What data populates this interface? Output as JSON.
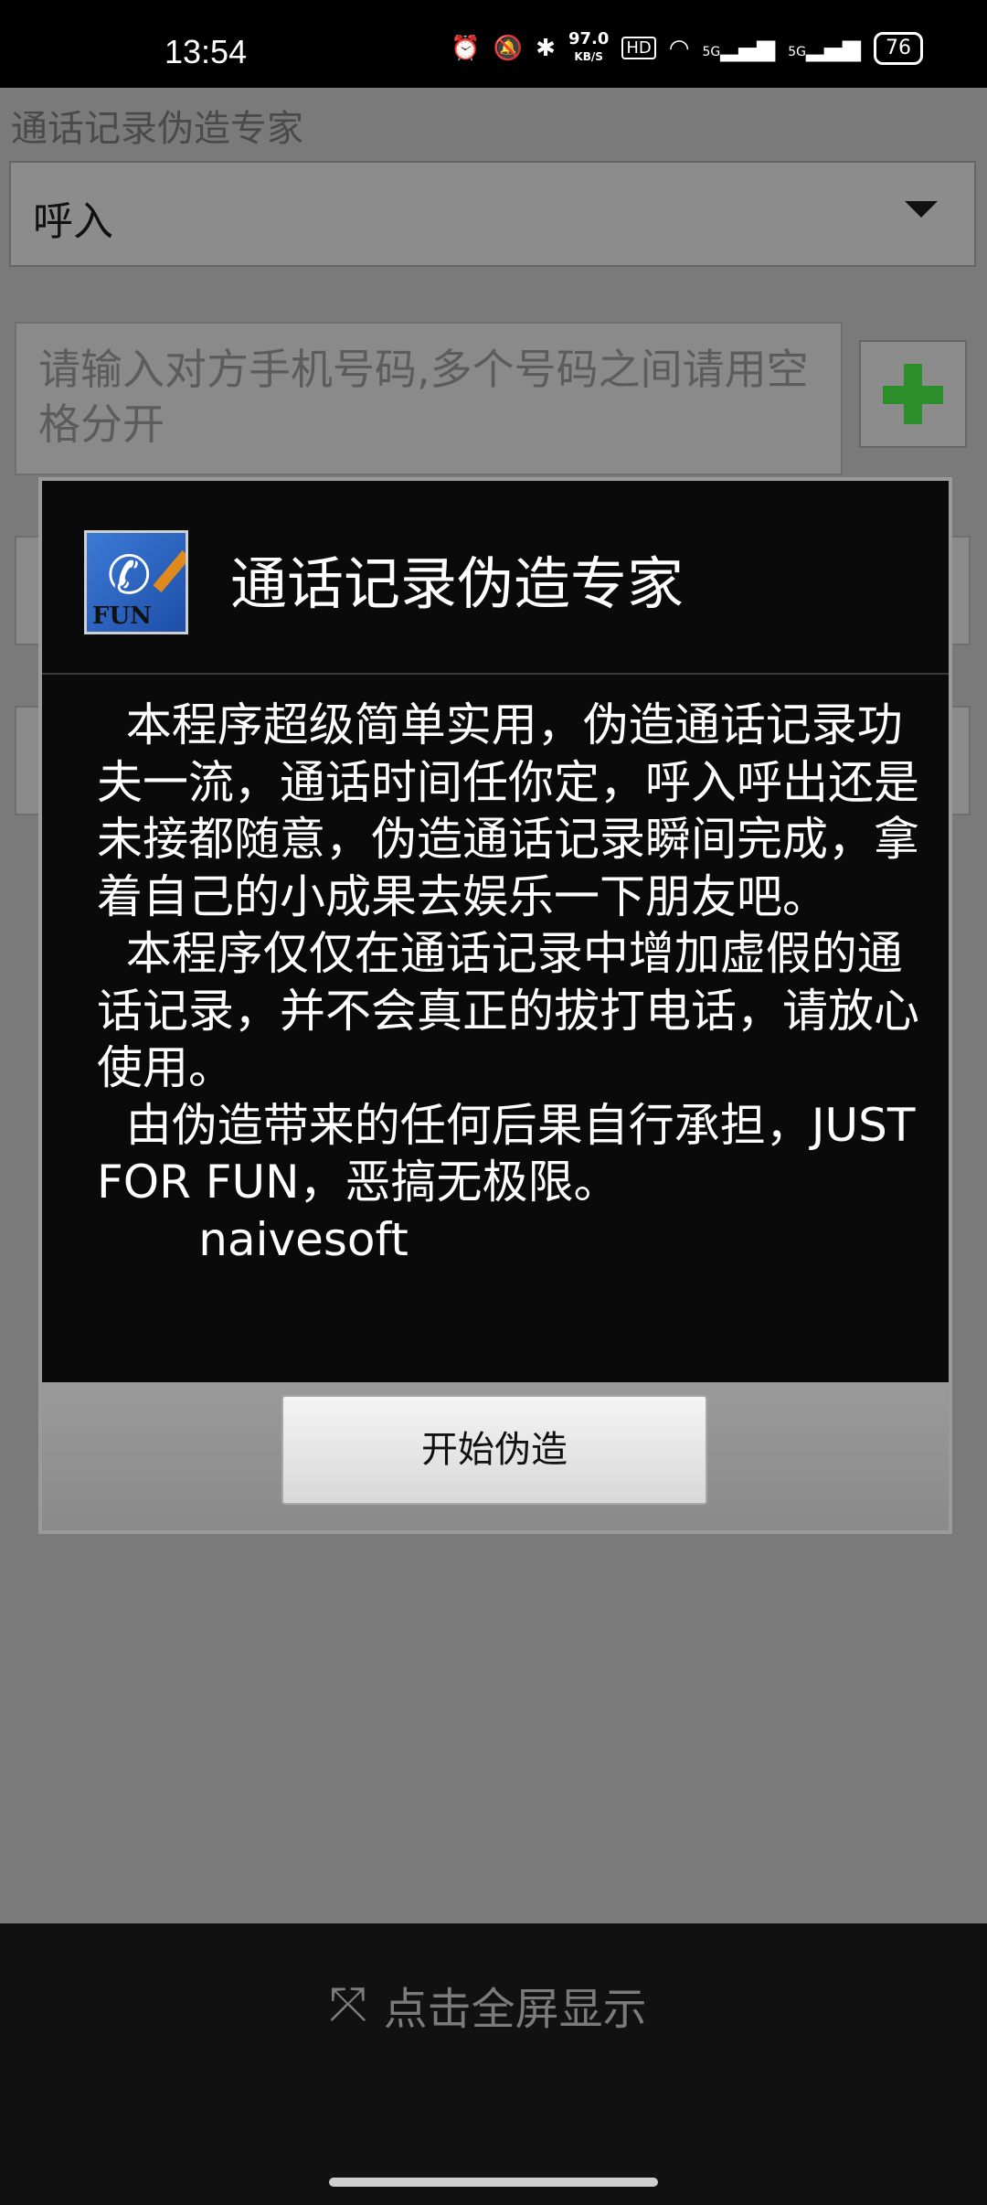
{
  "status": {
    "time": "13:54",
    "net_speed_value": "97.0",
    "net_speed_unit": "KB/S",
    "hd_badge": "HD",
    "signal1": "5G",
    "signal2": "5G",
    "battery": "76",
    "icons": [
      "alarm-icon",
      "mute-icon",
      "bluetooth-icon",
      "wifi-icon",
      "signal-icon",
      "battery-icon"
    ]
  },
  "app": {
    "title": "通话记录伪造专家",
    "call_type": "呼入",
    "phone_placeholder": "请输入对方手机号码,多个号码之间请用空格分开"
  },
  "dialog": {
    "title": "通话记录伪造专家",
    "icon_text": "FUN",
    "paragraphs": [
      "  本程序超级简单实用，伪造通话记录功夫一流，通话时间任你定，呼入呼出还是未接都随意，伪造通话记录瞬间完成，拿着自己的小成果去娱乐一下朋友吧。",
      "  本程序仅仅在通话记录中增加虚假的通话记录，并不会真正的拔打电话，请放心使用。",
      "  由伪造带来的任何后果自行承担，JUST FOR FUN，恶搞无极限。",
      "       naivesoft"
    ],
    "button_label": "开始伪造"
  },
  "adbar": {
    "fullscreen_label": "点击全屏显示"
  }
}
